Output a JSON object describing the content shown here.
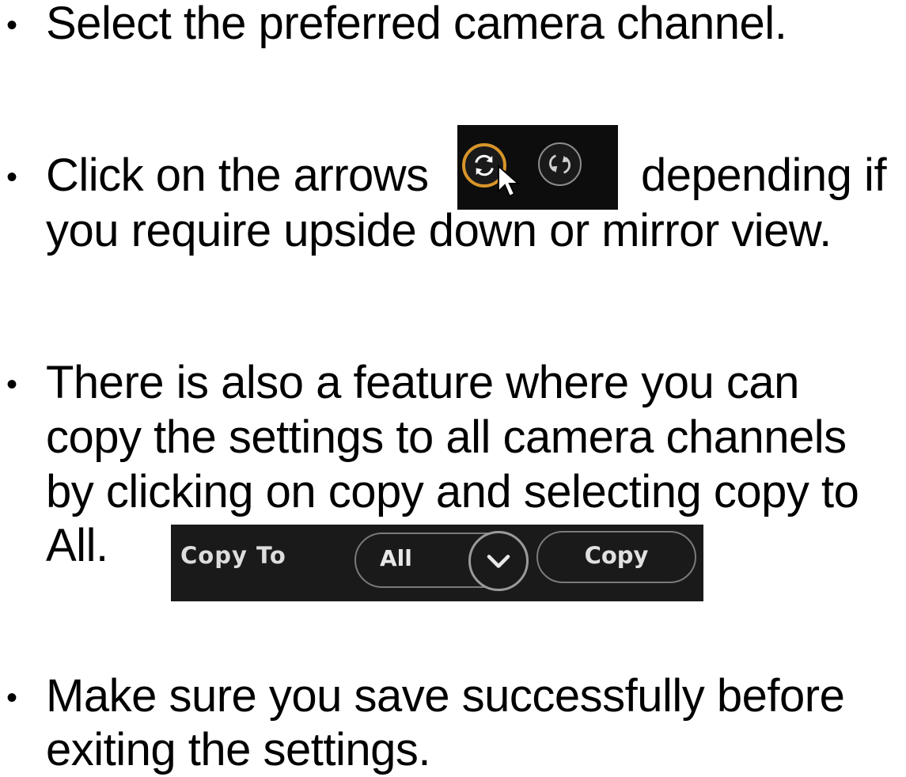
{
  "bullets": [
    {
      "lines": [
        "Select the preferred camera channel."
      ]
    },
    {
      "lines": [
        "Click on the arrows",
        "depending if",
        "you require upside down or mirror view."
      ]
    },
    {
      "lines": [
        "There is also a feature where you can",
        "copy the settings to all camera channels",
        "by clicking on copy and selecting copy to",
        "All."
      ]
    },
    {
      "lines": [
        "Make sure you save successfully before",
        "exiting the settings."
      ]
    }
  ],
  "bullet_glyph": "•",
  "rotate_panel": {
    "buttons": [
      {
        "icon": "flip-arrows-icon",
        "active": true,
        "accent": "#d7952a"
      },
      {
        "icon": "mirror-arrows-icon",
        "active": false
      }
    ],
    "cursor_icon": "mouse-pointer-icon"
  },
  "copy_panel": {
    "label": "Copy To",
    "select_value": "All",
    "dropdown_icon": "chevron-down-icon",
    "button_label": "Copy"
  }
}
